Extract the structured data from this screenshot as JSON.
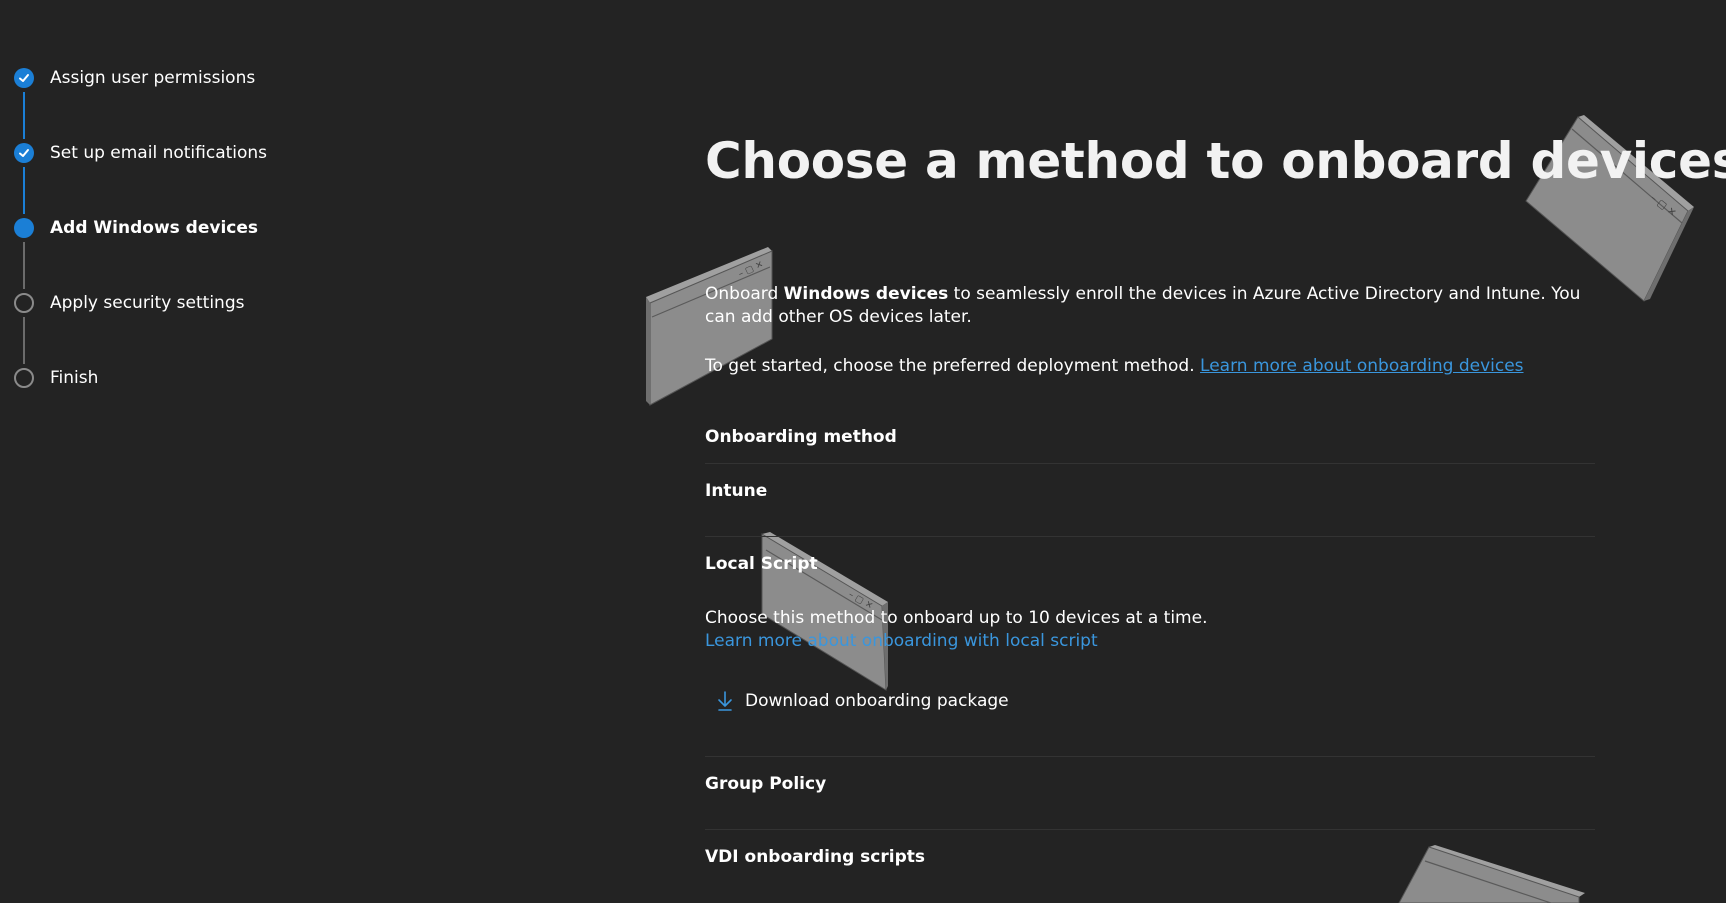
{
  "stepper": {
    "steps": [
      {
        "label": "Assign user permissions",
        "state": "done"
      },
      {
        "label": "Set up email notifications",
        "state": "done"
      },
      {
        "label": "Add Windows devices",
        "state": "current"
      },
      {
        "label": "Apply security settings",
        "state": "todo"
      },
      {
        "label": "Finish",
        "state": "todo"
      }
    ]
  },
  "main": {
    "title": "Choose a method to onboard devices",
    "intro_pre": "Onboard ",
    "intro_bold": "Windows devices",
    "intro_post": " to seamlessly enroll the devices in Azure Active Directory and Intune. You can add other OS devices later.",
    "start_text": "To get started, choose the preferred deployment method. ",
    "start_link": "Learn more about onboarding devices",
    "section_heading": "Onboarding method",
    "methods": {
      "intune": "Intune",
      "local_script": "Local Script",
      "group_policy": "Group Policy",
      "vdi": "VDI onboarding scripts"
    },
    "local_script_desc": "Choose this method to onboard up to 10 devices at a time.",
    "local_script_link": "Learn more about onboarding with local script",
    "download_label": "Download onboarding package"
  },
  "colors": {
    "background": "#232323",
    "accent": "#1b7fd6",
    "link": "#3a96dd",
    "pending": "#8a8a8a"
  }
}
